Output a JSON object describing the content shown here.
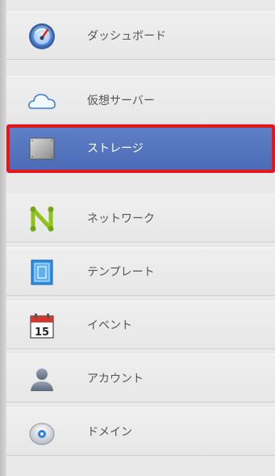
{
  "sidebar": {
    "items": [
      {
        "label": "ダッシュボード",
        "icon": "dashboard-gauge-icon"
      },
      {
        "label": "仮想サーバー",
        "icon": "cloud-icon"
      },
      {
        "label": "ストレージ",
        "icon": "hard-drive-icon",
        "active": true
      },
      {
        "label": "ネットワーク",
        "icon": "network-n-icon"
      },
      {
        "label": "テンプレート",
        "icon": "template-icon"
      },
      {
        "label": "イベント",
        "icon": "calendar-icon",
        "calendar_day": "15"
      },
      {
        "label": "アカウント",
        "icon": "user-icon"
      },
      {
        "label": "ドメイン",
        "icon": "domain-disc-icon"
      }
    ]
  },
  "colors": {
    "active_background": "#5070bb",
    "highlight_border": "#e4161b",
    "item_background": "#ececec",
    "label_text": "#555555",
    "active_label_text": "#ffffff"
  }
}
